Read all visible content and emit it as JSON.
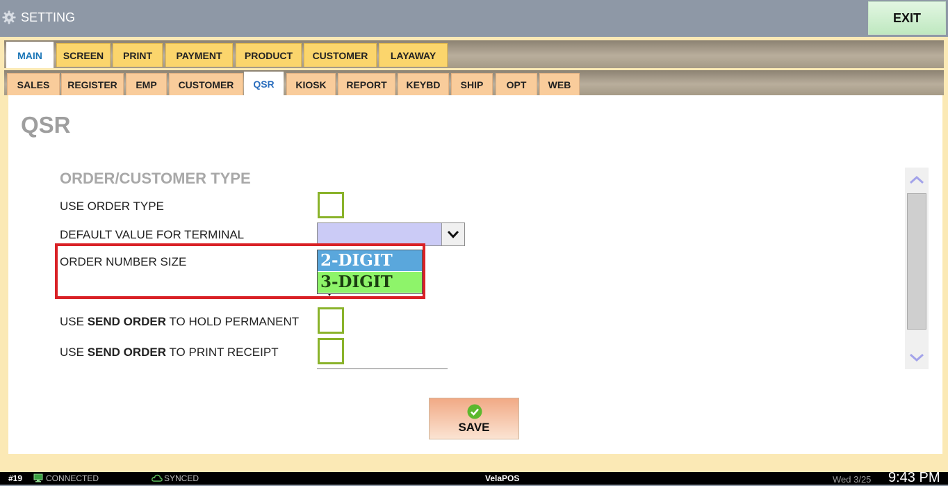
{
  "window": {
    "title": "SETTING",
    "exit_label": "EXIT"
  },
  "main_tabs": [
    {
      "label": "MAIN",
      "active": true
    },
    {
      "label": "SCREEN",
      "active": false
    },
    {
      "label": "PRINT",
      "active": false
    },
    {
      "label": "PAYMENT",
      "active": false
    },
    {
      "label": "PRODUCT",
      "active": false
    },
    {
      "label": "CUSTOMER",
      "active": false
    },
    {
      "label": "LAYAWAY",
      "active": false
    }
  ],
  "sub_tabs": [
    {
      "label": "SALES",
      "active": false
    },
    {
      "label": "REGISTER",
      "active": false
    },
    {
      "label": "EMP",
      "active": false
    },
    {
      "label": "CUSTOMER",
      "active": false
    },
    {
      "label": "QSR",
      "active": true
    },
    {
      "label": "KIOSK",
      "active": false
    },
    {
      "label": "REPORT",
      "active": false
    },
    {
      "label": "KEYBD",
      "active": false
    },
    {
      "label": "SHIP",
      "active": false
    },
    {
      "label": "OPT",
      "active": false
    },
    {
      "label": "WEB",
      "active": false
    }
  ],
  "page": {
    "title": "QSR",
    "section_title": "ORDER/CUSTOMER TYPE",
    "settings": {
      "use_order_type": {
        "label": "USE ORDER TYPE",
        "checked": false
      },
      "default_value": {
        "label": "DEFAULT VALUE FOR TERMINAL",
        "value": ""
      },
      "order_number_size": {
        "label": "ORDER NUMBER SIZE",
        "options": [
          "2-DIGIT",
          "3-DIGIT"
        ],
        "highlighted": "2-DIGIT"
      },
      "hold_permanent": {
        "prefix": "USE ",
        "bold": "SEND ORDER",
        "suffix": " TO HOLD PERMANENT",
        "checked": false
      },
      "print_receipt": {
        "prefix": "USE ",
        "bold": "SEND ORDER",
        "suffix": " TO PRINT RECEIPT",
        "checked": false
      }
    },
    "save_label": "SAVE"
  },
  "status_bar": {
    "terminal": "#19",
    "connection": "CONNECTED",
    "sync": "SYNCED",
    "app_name": "VelaPOS",
    "date": "Wed 3/25",
    "time": "9:43 PM"
  },
  "colors": {
    "title_bar": "#8e98a6",
    "main_tab": "#fbd56c",
    "sub_tab": "#f9cc9b",
    "checkbox_border": "#8ab32b",
    "highlight_box": "#d92126",
    "option_selected": "#5aa7dc",
    "option_alt": "#8ef46a"
  },
  "icons": {
    "title": "gear-icon",
    "select_arrow": "chevron-down-icon",
    "scroll_up": "chevron-up-icon",
    "scroll_down": "chevron-down-icon",
    "save": "check-circle-icon",
    "connection": "network-icon",
    "sync": "cloud-icon"
  }
}
